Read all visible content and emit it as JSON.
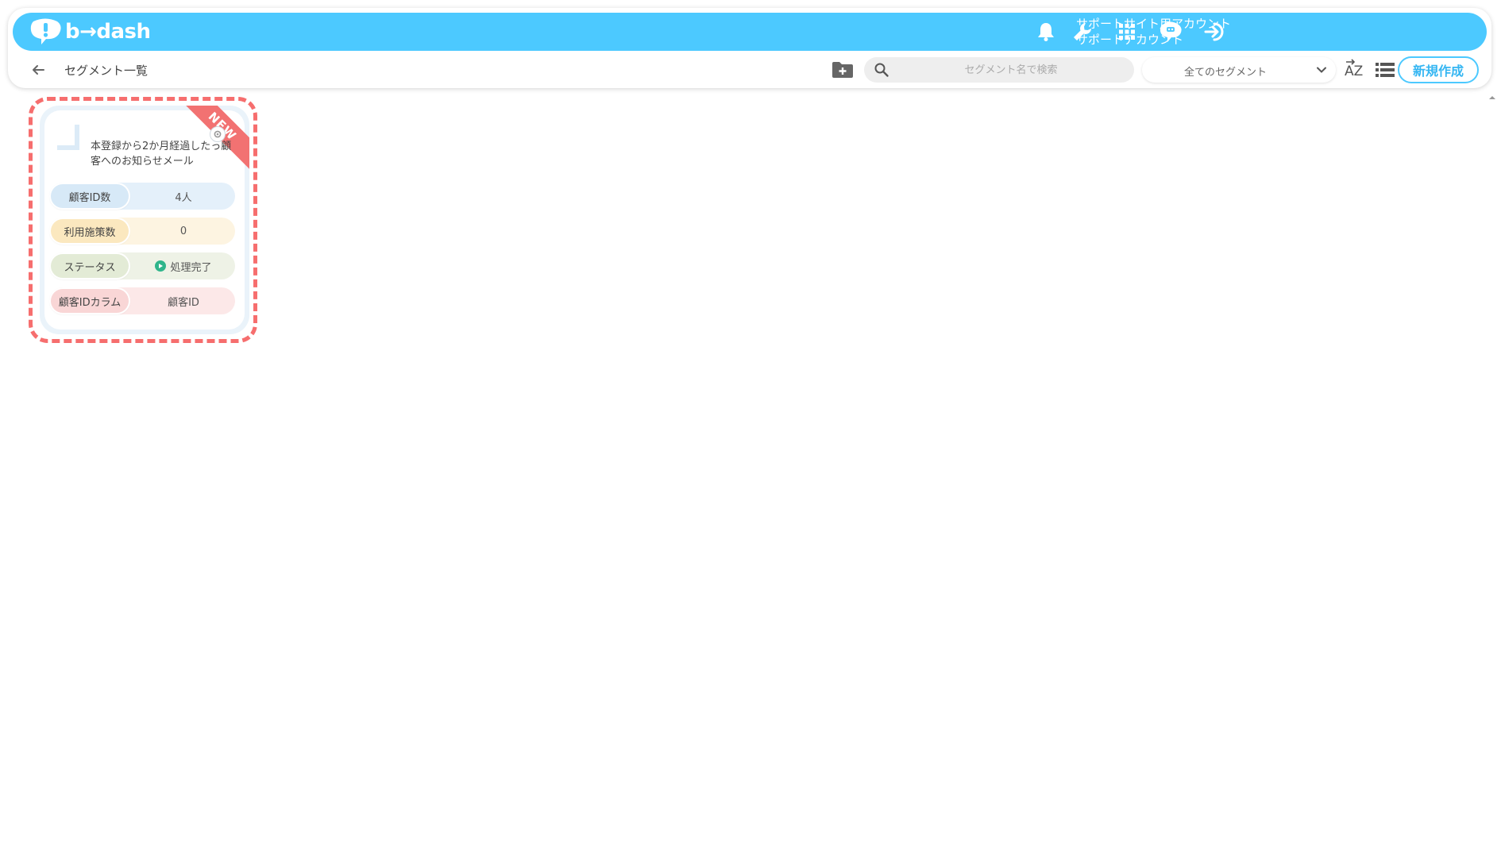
{
  "header": {
    "logo_text": "b→dash",
    "account_line1": "サポートサイト用アカウント",
    "account_line2": "サポートアカウント",
    "icons": [
      "bell-icon",
      "wrench-icon",
      "apps-grid-icon",
      "support-chat-icon",
      "logout-icon"
    ],
    "brand_color": "#4cc9ff"
  },
  "subbar": {
    "page_title": "セグメント一覧",
    "search_placeholder": "セグメント名で検索",
    "filter_selected": "全てのセグメント",
    "sort_label": "AZ",
    "new_button_label": "新規作成"
  },
  "segments": [
    {
      "badge": "NEW",
      "title": "本登録から2か月経過したっ顧客へのお知らせメール",
      "rows": [
        {
          "label": "顧客ID数",
          "value": "4人"
        },
        {
          "label": "利用施策数",
          "value": "0"
        },
        {
          "label": "ステータス",
          "value": "処理完了"
        },
        {
          "label": "顧客IDカラム",
          "value": "顧客ID"
        }
      ]
    }
  ]
}
